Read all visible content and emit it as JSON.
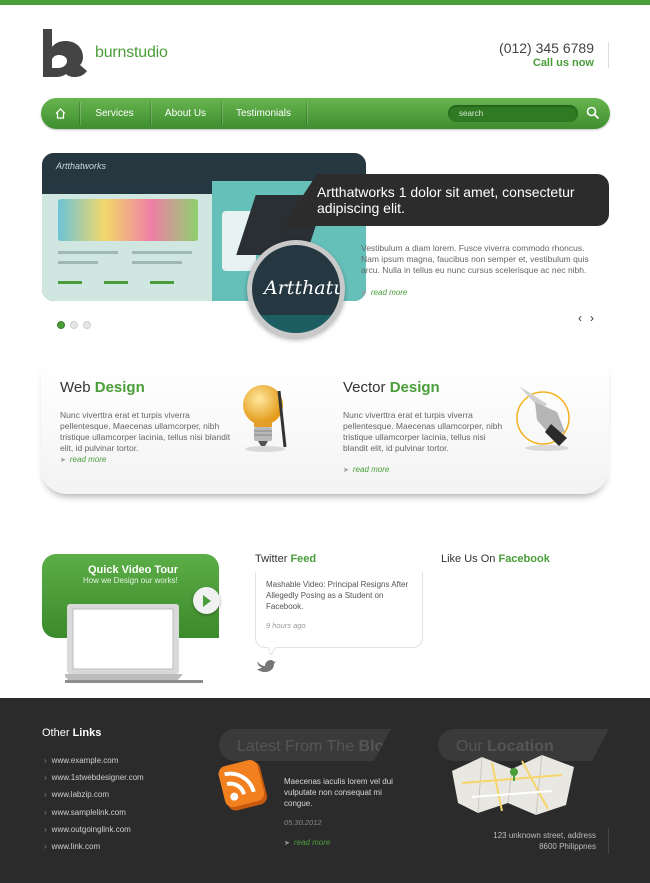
{
  "header": {
    "brand": "burnstudio",
    "phone": "(012) 345 6789",
    "call_text": "Call us now"
  },
  "nav": {
    "items": [
      {
        "label": "Services"
      },
      {
        "label": "About Us"
      },
      {
        "label": "Testimonials"
      }
    ],
    "search_placeholder": "search"
  },
  "slider": {
    "site_name": "Artthatworks",
    "circle_text": "Artthatu",
    "caption": "Artthatworks 1 dolor sit amet, consectetur adipiscing elit.",
    "description": "Vestibulum a diam lorem. Fusce viverra commodo rhoncus. Nam ipsum magna, faucibus non semper et, vestibulum quis arcu. Nulla in tellus eu nunc cursus scelerisque ac nec nibh.",
    "read_more": "read more",
    "dots": 3,
    "active_dot": 0
  },
  "services": [
    {
      "title_plain": "Web ",
      "title_accent": "Design",
      "text": "Nunc viverttra erat et turpis viverra pellentesque. Maecenas ullamcorper, nibh tristique ullamcorper lacinia, tellus nisi blandit elit, id pulvinar tortor.",
      "read_more": "read more"
    },
    {
      "title_plain": "Vector ",
      "title_accent": "Design",
      "text": "Nunc viverttra erat et turpis viverra pellentesque. Maecenas ullamcorper, nibh tristique ullamcorper lacinia, tellus nisi blandit elit, id pulvinar tortor.",
      "read_more": "read more"
    }
  ],
  "video": {
    "title_plain": "Quick ",
    "title_accent": "Video Tour",
    "subtitle": "How we Design our works!"
  },
  "twitter": {
    "title_plain": "Twitter ",
    "title_accent": "Feed",
    "tweet": "Mashable Video: Principal Resigns After Allegedly Posing as a Student on Facebook.",
    "time": "9 hours ago"
  },
  "facebook": {
    "title_plain": "Like Us On ",
    "title_accent": "Facebook"
  },
  "footer": {
    "links_title_plain": "Other ",
    "links_title_accent": "Links",
    "links": [
      "www.example.com",
      "www.1stwebdesigner.com",
      "www.labzip.com",
      "www.samplelink.com",
      "www.outgoinglink.com",
      "www.link.com"
    ],
    "blog_title_plain": "Latest From The ",
    "blog_title_accent": "Blog",
    "blog_text": "Maecenas iaculis lorem vel dui vulputate non consequat mi congue.",
    "blog_date": "05.30.2012",
    "blog_read_more": "read more",
    "location_title_plain": "Our ",
    "location_title_accent": "Location",
    "address_line1": "123 unknown street, address",
    "address_line2": "8600 Philippnes"
  },
  "colors": {
    "accent": "#4a9e3a",
    "dark": "#2b2b2b"
  }
}
